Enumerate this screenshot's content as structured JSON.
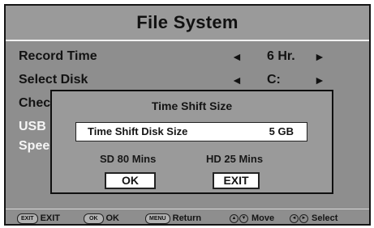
{
  "title": "File System",
  "rows": [
    {
      "label": "Record Time",
      "value": "6 Hr."
    },
    {
      "label": "Select Disk",
      "value": "C:"
    },
    {
      "label": "Chec"
    },
    {
      "label": "USB"
    },
    {
      "label": "Spee"
    }
  ],
  "arrows": {
    "left": "◄",
    "right": "►"
  },
  "dialog": {
    "title": "Time Shift Size",
    "field_label": "Time Shift Disk Size",
    "field_value": "5 GB",
    "sd": "SD 80 Mins",
    "hd": "HD 25 Mins",
    "ok": "OK",
    "exit": "EXIT"
  },
  "footer": {
    "exit_key": "EXIT",
    "exit_label": "EXIT",
    "ok_key": "OK",
    "ok_label": "OK",
    "menu_key": "MENU",
    "menu_label": "Return",
    "move_label": "Move",
    "select_label": "Select"
  },
  "colors": {
    "background": "#8e8e8e",
    "border": "#141414",
    "field": "#ffffff"
  }
}
